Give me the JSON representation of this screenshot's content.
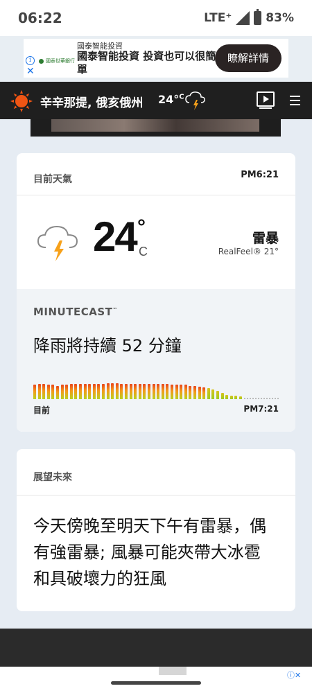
{
  "status_bar": {
    "time": "06:22",
    "network": "LTE⁺",
    "battery": "83%"
  },
  "ad": {
    "sponsor": "國泰智能投資",
    "headline": "國泰智能投資 投資也可以很簡單",
    "logo_text": "國泰世華銀行",
    "cta": "瞭解詳情"
  },
  "header": {
    "location": "辛辛那提, 俄亥俄州",
    "temp": "24°",
    "unit": "C",
    "icons": [
      "sun-logo-icon",
      "thunderstorm-icon",
      "video-icon",
      "menu-icon"
    ]
  },
  "current": {
    "label": "目前天氣",
    "time": "PM6:21",
    "temp": "24",
    "degree": "°",
    "unit": "C",
    "condition": "雷暴",
    "realfeel": "RealFeel® 21°"
  },
  "minutecast": {
    "label": "MINUTECAST",
    "trademark": "™",
    "summary": "降雨將持續 52 分鐘",
    "start_label": "目前",
    "end_label": "PM7:21",
    "bars": [
      0.8,
      0.85,
      0.85,
      0.8,
      0.8,
      0.75,
      0.8,
      0.8,
      0.85,
      0.85,
      0.85,
      0.85,
      0.85,
      0.85,
      0.85,
      0.85,
      0.9,
      0.9,
      0.9,
      0.85,
      0.85,
      0.85,
      0.85,
      0.85,
      0.85,
      0.85,
      0.85,
      0.85,
      0.85,
      0.85,
      0.8,
      0.8,
      0.8,
      0.8,
      0.75,
      0.75,
      0.7,
      0.65,
      0.6,
      0.55,
      0.45,
      0.35,
      0.25,
      0.2,
      0.18,
      0.15
    ]
  },
  "outlook": {
    "label": "展望未來",
    "text": "今天傍晚至明天下午有雷暴，偶有強雷暴; 風暴可能夾帶大冰雹和具破壞力的狂風"
  },
  "colors": {
    "header_bg": "#1f1f1f",
    "accent_orange": "#f05514",
    "page_bg": "#e6ecf3"
  }
}
